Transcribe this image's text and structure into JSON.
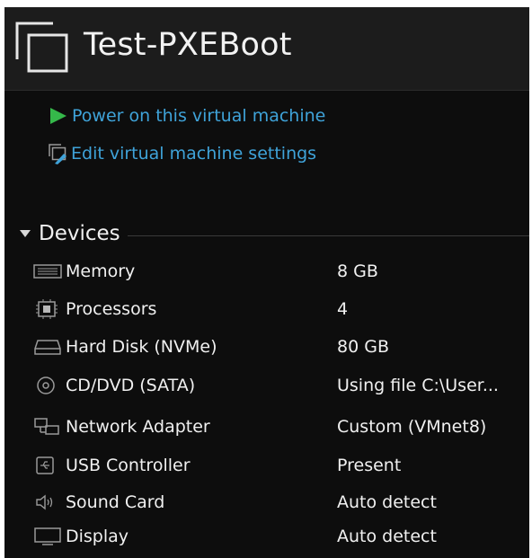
{
  "vm": {
    "title": "Test-PXEBoot"
  },
  "actions": [
    {
      "label": "Power on this virtual machine",
      "icon": "play-icon"
    },
    {
      "label": "Edit virtual machine settings",
      "icon": "edit-settings-icon"
    }
  ],
  "devices": {
    "label": "Devices",
    "items": [
      {
        "name": "Memory",
        "value": "8 GB",
        "icon": "memory-icon"
      },
      {
        "name": "Processors",
        "value": "4",
        "icon": "processor-icon"
      },
      {
        "name": "Hard Disk (NVMe)",
        "value": "80 GB",
        "icon": "hard-disk-icon"
      },
      {
        "name": "CD/DVD (SATA)",
        "value": "Using file C:\\User...",
        "icon": "cd-dvd-icon"
      },
      {
        "name": "Network Adapter",
        "value": "Custom (VMnet8)",
        "icon": "network-adapter-icon"
      },
      {
        "name": "USB Controller",
        "value": "Present",
        "icon": "usb-icon"
      },
      {
        "name": "Sound Card",
        "value": "Auto detect",
        "icon": "sound-card-icon"
      },
      {
        "name": "Display",
        "value": "Auto detect",
        "icon": "display-icon"
      }
    ]
  },
  "colors": {
    "background": "#0d0d0d",
    "header": "#1c1c1c",
    "link": "#3fa3d9",
    "play": "#35b84a",
    "text": "#f0f0f0"
  }
}
